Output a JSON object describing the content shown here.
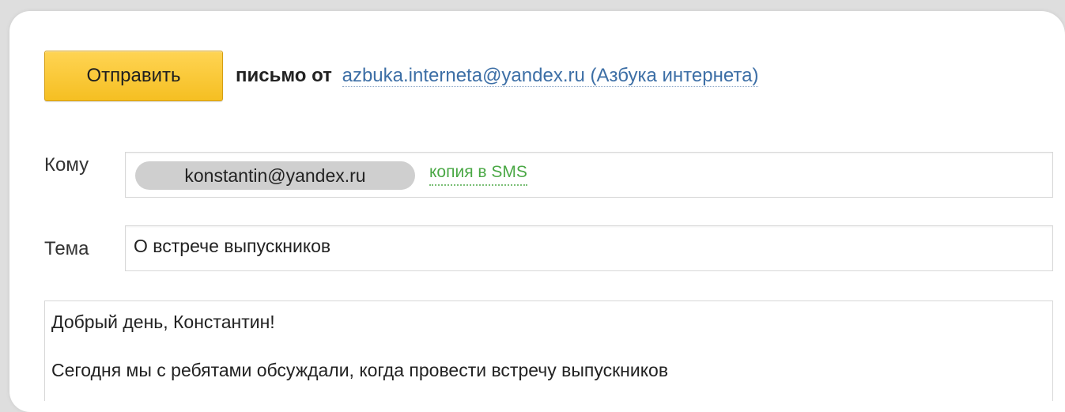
{
  "compose": {
    "send_button_label": "Отправить",
    "from_prefix": "письмо от",
    "from_address": "azbuka.interneta@yandex.ru (Азбука интернета)",
    "to_label": "Кому",
    "to_recipient": "konstantin@yandex.ru",
    "sms_copy_link": "копия в SMS",
    "subject_label": "Тема",
    "subject_value": "О встрече выпускников",
    "body_lines": [
      "Добрый день, Константин!",
      "Сегодня мы с ребятами обсуждали, когда провести встречу выпускников"
    ]
  },
  "colors": {
    "send_button": "#f5bf22",
    "from_link": "#3d6fa6",
    "sms_link": "#4aa845",
    "recipient_chip": "#cfcfcf"
  }
}
